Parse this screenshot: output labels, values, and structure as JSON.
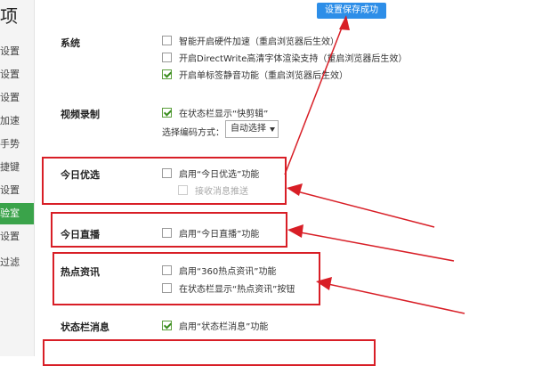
{
  "sidebar": {
    "title": "项",
    "items": [
      {
        "label": "设置",
        "active": false
      },
      {
        "label": "设置",
        "active": false
      },
      {
        "label": "设置",
        "active": false
      },
      {
        "label": "加速",
        "active": false
      },
      {
        "label": "手势",
        "active": false
      },
      {
        "label": "捷键",
        "active": false
      },
      {
        "label": "设置",
        "active": false
      },
      {
        "label": "验室",
        "active": true
      },
      {
        "label": "设置",
        "active": false
      },
      {
        "label": "过滤",
        "active": false
      }
    ]
  },
  "toast": "设置保存成功",
  "sections": {
    "system": {
      "title": "系统",
      "options": [
        {
          "label": "智能开启硬件加速（重启浏览器后生效）",
          "checked": false
        },
        {
          "label": "开启DirectWrite高清字体渲染支持（重启浏览器后生效）",
          "checked": false
        },
        {
          "label": "开启单标签静音功能（重启浏览器后生效）",
          "checked": true
        }
      ]
    },
    "video": {
      "title": "视频录制",
      "options": [
        {
          "label": "在状态栏显示“快剪辑”",
          "checked": true
        }
      ],
      "encode_label": "选择编码方式：",
      "encode_value": "自动选择"
    },
    "today_pick": {
      "title": "今日优选",
      "options": [
        {
          "label": "启用“今日优选”功能",
          "checked": false
        },
        {
          "label": "接收消息推送",
          "checked": false,
          "disabled": true
        }
      ]
    },
    "today_live": {
      "title": "今日直播",
      "options": [
        {
          "label": "启用“今日直播”功能",
          "checked": false
        }
      ]
    },
    "hot_news": {
      "title": "热点资讯",
      "options": [
        {
          "label": "启用“360热点资讯”功能",
          "checked": false
        },
        {
          "label": "在状态栏显示“热点资讯”按钮",
          "checked": false
        }
      ]
    },
    "statusbar": {
      "title": "状态栏消息",
      "options": [
        {
          "label": "启用“状态栏消息”功能",
          "checked": true
        }
      ]
    }
  },
  "colors": {
    "accent_green": "#3aa34a",
    "toast_blue": "#2d8ee8",
    "highlight_red": "#d81e26"
  }
}
